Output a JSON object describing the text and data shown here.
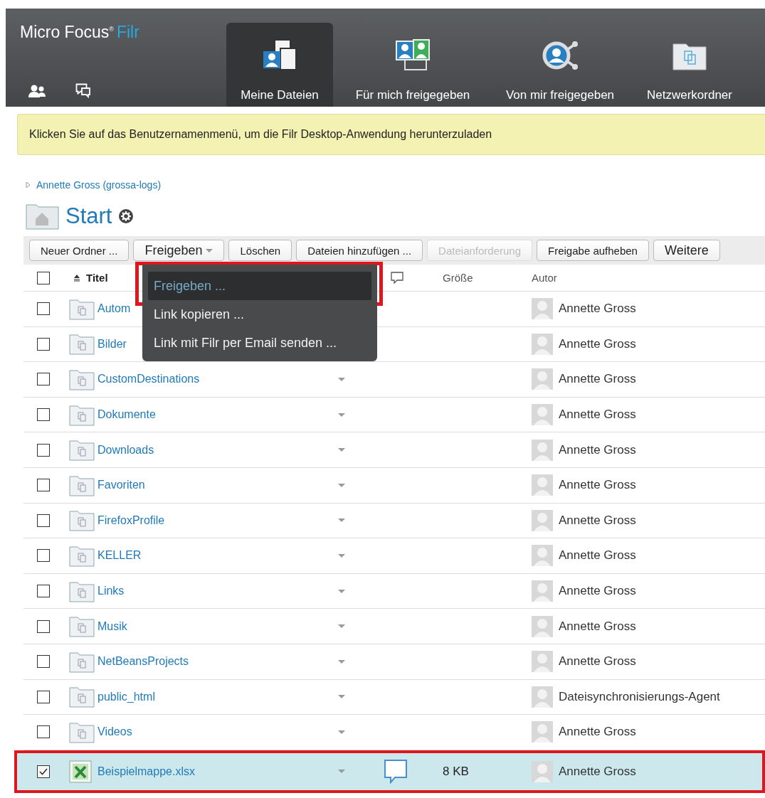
{
  "header": {
    "brand": "Micro Focus",
    "brand_mark": "®",
    "product": "Filr",
    "tabs": [
      {
        "label": "Meine Dateien",
        "kind": "files",
        "selected": true
      },
      {
        "label": "Für mich freigegeben",
        "kind": "shared_with_me",
        "selected": false
      },
      {
        "label": "Von mir freigegeben",
        "kind": "shared_by_me",
        "selected": false
      },
      {
        "label": "Netzwerkordner",
        "kind": "net_folders",
        "selected": false
      }
    ]
  },
  "banner": "Klicken Sie auf das Benutzernamenmenü, um die Filr Desktop-Anwendung herunterzuladen",
  "breadcrumb": "Annette Gross (grossa-logs)",
  "title": "Start",
  "toolbar": [
    {
      "label": "Neuer Ordner ...",
      "kind": "button",
      "disabled": false
    },
    {
      "label": "Freigeben",
      "kind": "dropdown",
      "disabled": false
    },
    {
      "label": "Löschen",
      "kind": "button",
      "disabled": false
    },
    {
      "label": "Dateien hinzufügen ...",
      "kind": "button",
      "disabled": false
    },
    {
      "label": "Dateianforderung",
      "kind": "button",
      "disabled": true
    },
    {
      "label": "Freigabe aufheben",
      "kind": "button",
      "disabled": false
    },
    {
      "label": "Weitere",
      "kind": "button",
      "disabled": false
    }
  ],
  "table": {
    "select_all_checked": false,
    "columns": [
      "Titel",
      "Größe",
      "Autor"
    ],
    "rows": [
      {
        "name": "Autom",
        "kind": "folder",
        "checked": false,
        "selected": false,
        "highlighted": false,
        "menu_arrow": false,
        "comment": false,
        "author": "Annette Gross"
      },
      {
        "name": "Bilder",
        "kind": "folder",
        "checked": false,
        "selected": false,
        "highlighted": false,
        "menu_arrow": false,
        "comment": false,
        "author": "Annette Gross"
      },
      {
        "name": "CustomDestinations",
        "kind": "folder",
        "checked": false,
        "selected": false,
        "highlighted": false,
        "menu_arrow": true,
        "comment": false,
        "author": "Annette Gross"
      },
      {
        "name": "Dokumente",
        "kind": "folder",
        "checked": false,
        "selected": false,
        "highlighted": false,
        "menu_arrow": true,
        "comment": false,
        "author": "Annette Gross"
      },
      {
        "name": "Downloads",
        "kind": "folder",
        "checked": false,
        "selected": false,
        "highlighted": false,
        "menu_arrow": true,
        "comment": false,
        "author": "Annette Gross"
      },
      {
        "name": "Favoriten",
        "kind": "folder",
        "checked": false,
        "selected": false,
        "highlighted": false,
        "menu_arrow": true,
        "comment": false,
        "author": "Annette Gross"
      },
      {
        "name": "FirefoxProfile",
        "kind": "folder",
        "checked": false,
        "selected": false,
        "highlighted": false,
        "menu_arrow": true,
        "comment": false,
        "author": "Annette Gross"
      },
      {
        "name": "KELLER",
        "kind": "folder",
        "checked": false,
        "selected": false,
        "highlighted": false,
        "menu_arrow": true,
        "comment": false,
        "author": "Annette Gross"
      },
      {
        "name": "Links",
        "kind": "folder",
        "checked": false,
        "selected": false,
        "highlighted": false,
        "menu_arrow": true,
        "comment": false,
        "author": "Annette Gross"
      },
      {
        "name": "Musik",
        "kind": "folder",
        "checked": false,
        "selected": false,
        "highlighted": false,
        "menu_arrow": true,
        "comment": false,
        "author": "Annette Gross"
      },
      {
        "name": "NetBeansProjects",
        "kind": "folder",
        "checked": false,
        "selected": false,
        "highlighted": false,
        "menu_arrow": true,
        "comment": false,
        "author": "Annette Gross"
      },
      {
        "name": "public_html",
        "kind": "folder",
        "checked": false,
        "selected": false,
        "highlighted": false,
        "menu_arrow": true,
        "comment": false,
        "author": "Dateisynchronisierungs-Agent"
      },
      {
        "name": "Videos",
        "kind": "folder",
        "checked": false,
        "selected": false,
        "highlighted": false,
        "menu_arrow": true,
        "comment": false,
        "author": "Annette Gross"
      },
      {
        "name": "Beispielmappe.xlsx",
        "kind": "spreadsheet",
        "checked": true,
        "selected": true,
        "highlighted": true,
        "menu_arrow": true,
        "comment": true,
        "size": "8 KB",
        "author": "Annette Gross"
      }
    ]
  },
  "dropdown_menu": [
    {
      "label": "Freigeben ...",
      "selected": true,
      "highlighted": true
    },
    {
      "label": "Link kopieren ...",
      "selected": false,
      "highlighted": false
    },
    {
      "label": "Link mit Filr per Email senden ...",
      "selected": false,
      "highlighted": false
    }
  ]
}
